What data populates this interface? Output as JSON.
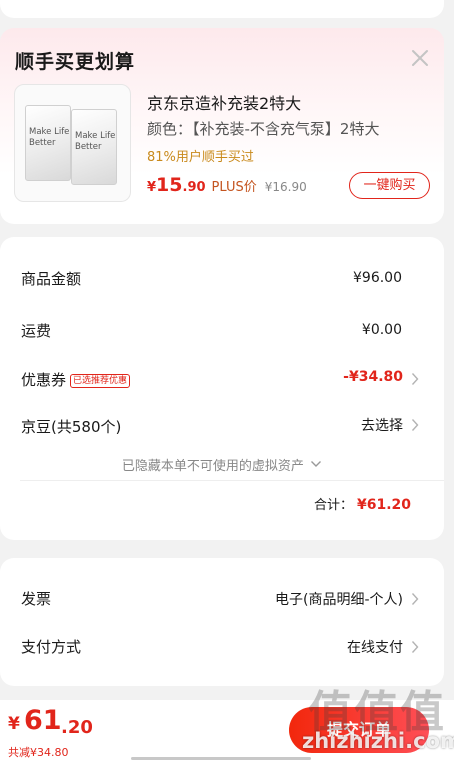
{
  "addon": {
    "title": "顺手买更划算",
    "product": {
      "name": "京东京造补充装2特大",
      "color_line": "颜色：【补充装-不含充气泵】2特大",
      "buy_rate": "81%用户顺手买过",
      "price_symbol": "¥",
      "price_int": "15",
      "price_dec": ".90",
      "plus_label": "PLUS价",
      "original_price": "¥16.90",
      "buy_button": "一键购买",
      "image_text_1": "Make Life Better",
      "image_text_2": "Make Life Better"
    }
  },
  "summary": {
    "goods_label": "商品金额",
    "goods_value": "¥96.00",
    "shipping_label": "运费",
    "shipping_value": "¥0.00",
    "coupon_label": "优惠券",
    "coupon_badge": "已选推荐优惠",
    "coupon_value": "-¥34.80",
    "jingdou_label": "京豆(共580个)",
    "jingdou_value": "去选择",
    "hidden_assets_note": "已隐藏本单不可使用的虚拟资产",
    "total_label": "合计：",
    "total_value": "¥61.20"
  },
  "payment": {
    "invoice_label": "发票",
    "invoice_value": "电子(商品明细-个人)",
    "method_label": "支付方式",
    "method_value": "在线支付"
  },
  "bottom_bar": {
    "price_symbol": "¥",
    "price_int": "61",
    "price_dec": ".20",
    "saved": "共减¥34.80",
    "submit_label": "提交订单"
  },
  "watermark": {
    "logo": "值值值",
    "site": "zhizhizhi.com"
  },
  "colors": {
    "accent": "#e1251b",
    "rate_text": "#c98a1c",
    "background": "#f2f2f2"
  },
  "icons": [
    "close-icon",
    "chevron-right-icon",
    "chevron-down-icon"
  ]
}
